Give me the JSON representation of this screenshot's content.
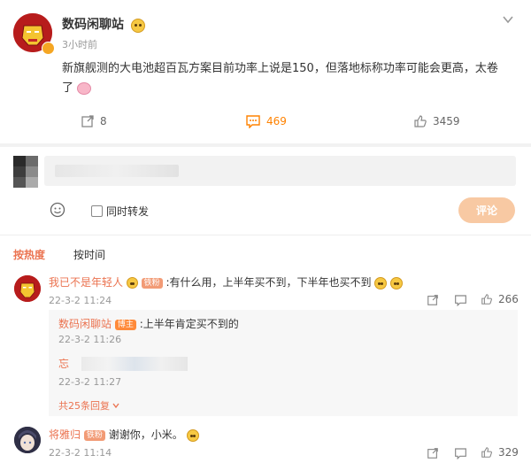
{
  "post": {
    "author": "数码闲聊站",
    "time": "3小时前",
    "text_line1": "新旗舰测的大电池超百瓦方案目前功率上说是150，但落地标称功率可能会更高，太卷",
    "text_line2": "了",
    "repost_count": "8",
    "comment_count": "469",
    "like_count": "3459"
  },
  "composer": {
    "repost_checkbox_label": "同时转发",
    "submit_label": "评论"
  },
  "sort": {
    "hot": "按热度",
    "time": "按时间"
  },
  "comments": [
    {
      "user": "我已不是年轻人",
      "badge": "铁粉",
      "text": ":有什么用，上半年买不到，下半年也买不到",
      "time": "22-3-2 11:24",
      "likes": "266",
      "replies": [
        {
          "user": "数码闲聊站",
          "badge": "博主",
          "text": ":上半年肯定买不到的",
          "time": "22-3-2 11:26"
        },
        {
          "user": "忘",
          "text": "",
          "time": "22-3-2 11:27"
        }
      ],
      "more_replies": "共25条回复"
    },
    {
      "user": "将雅归",
      "badge": "铁粉",
      "text": "谢谢你，小米。",
      "time": "22-3-2 11:14",
      "likes": "329"
    }
  ],
  "colors": {
    "accent": "#eb7350",
    "comment_active": "#ff8200",
    "submit_bg": "#f8c9a3",
    "badge_fan": "#f29b76",
    "badge_owner": "#ff8a3a"
  }
}
